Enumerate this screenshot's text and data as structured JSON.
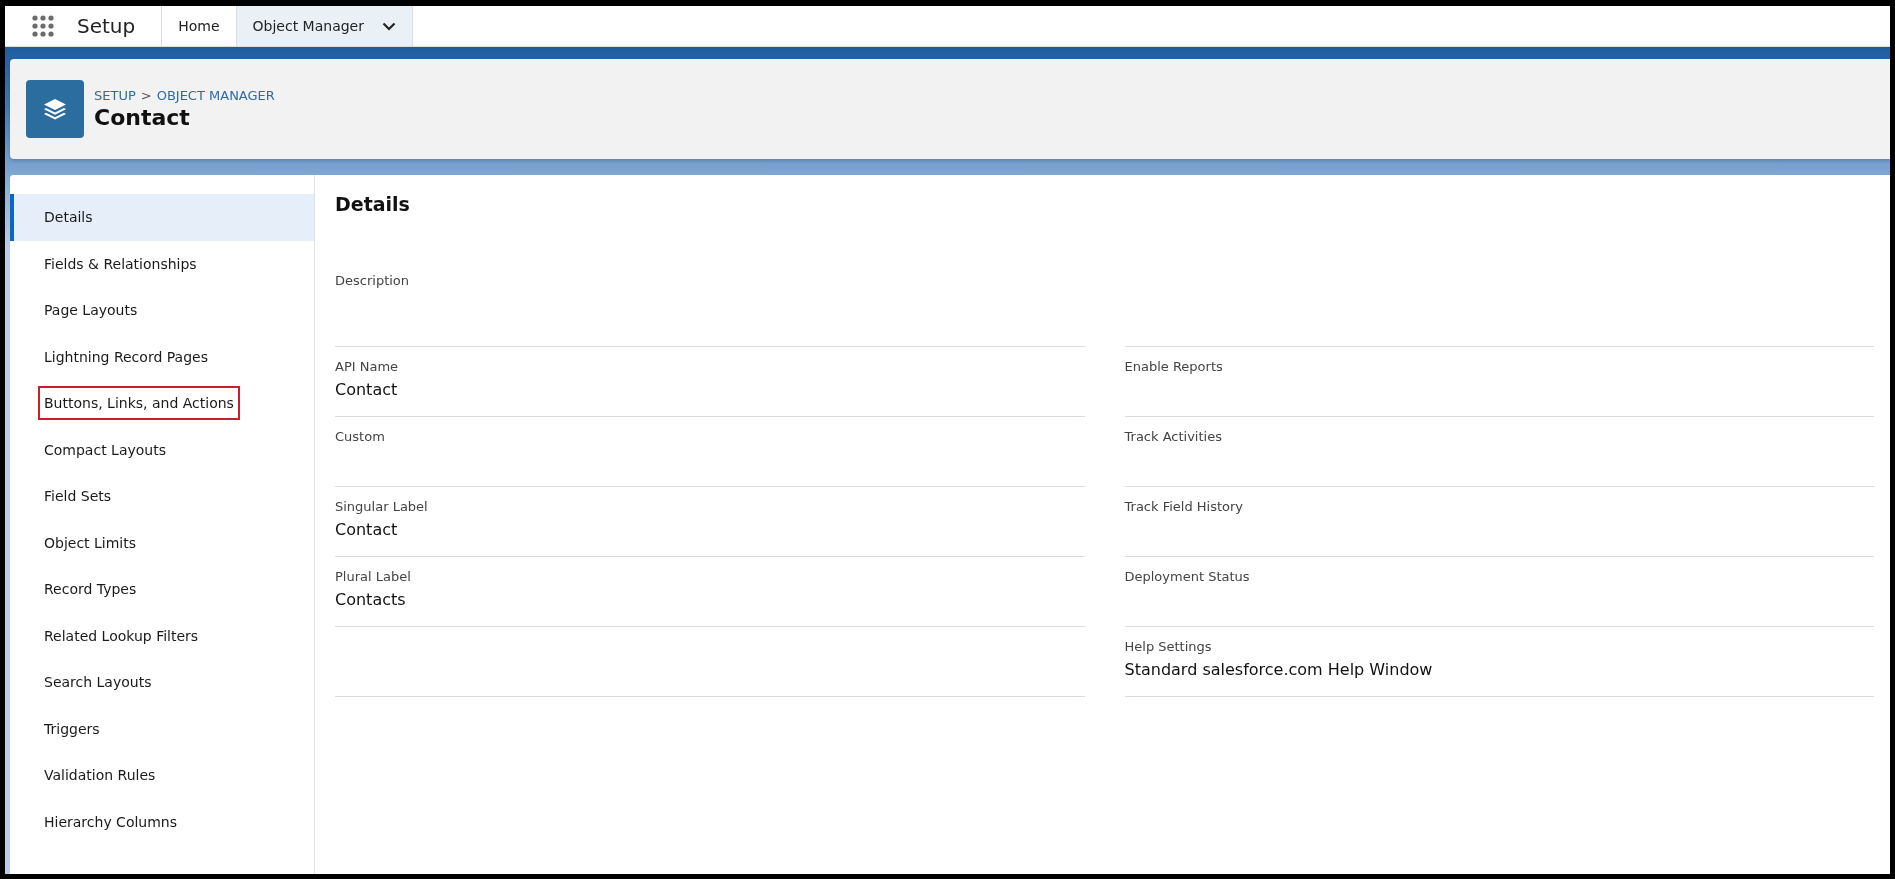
{
  "app": {
    "name": "Setup"
  },
  "tabs": [
    {
      "label": "Home",
      "selected": false,
      "dropdown": false
    },
    {
      "label": "Object Manager",
      "selected": true,
      "dropdown": true
    }
  ],
  "header": {
    "breadcrumb": [
      "SETUP",
      ">",
      "OBJECT MANAGER"
    ],
    "title": "Contact"
  },
  "sidebar": {
    "items": [
      {
        "label": "Details",
        "selected": true,
        "highlighted": false
      },
      {
        "label": "Fields & Relationships",
        "selected": false,
        "highlighted": false
      },
      {
        "label": "Page Layouts",
        "selected": false,
        "highlighted": false
      },
      {
        "label": "Lightning Record Pages",
        "selected": false,
        "highlighted": false
      },
      {
        "label": "Buttons, Links, and Actions",
        "selected": false,
        "highlighted": true
      },
      {
        "label": "Compact Layouts",
        "selected": false,
        "highlighted": false
      },
      {
        "label": "Field Sets",
        "selected": false,
        "highlighted": false
      },
      {
        "label": "Object Limits",
        "selected": false,
        "highlighted": false
      },
      {
        "label": "Record Types",
        "selected": false,
        "highlighted": false
      },
      {
        "label": "Related Lookup Filters",
        "selected": false,
        "highlighted": false
      },
      {
        "label": "Search Layouts",
        "selected": false,
        "highlighted": false
      },
      {
        "label": "Triggers",
        "selected": false,
        "highlighted": false
      },
      {
        "label": "Validation Rules",
        "selected": false,
        "highlighted": false
      },
      {
        "label": "Hierarchy Columns",
        "selected": false,
        "highlighted": false
      }
    ]
  },
  "details": {
    "title": "Details",
    "rows": [
      {
        "left": {
          "label": "Description"
        }
      },
      {
        "left": {
          "label": "API Name",
          "value": "Contact"
        },
        "right": {
          "label": "Enable Reports"
        }
      },
      {
        "left": {
          "label": "Custom"
        },
        "right": {
          "label": "Track Activities"
        }
      },
      {
        "left": {
          "label": "Singular Label",
          "value": "Contact"
        },
        "right": {
          "label": "Track Field History"
        }
      },
      {
        "left": {
          "label": "Plural Label",
          "value": "Contacts"
        },
        "right": {
          "label": "Deployment Status"
        }
      },
      {
        "right": {
          "label": "Help Settings",
          "value": "Standard salesforce.com Help Window"
        }
      }
    ]
  }
}
